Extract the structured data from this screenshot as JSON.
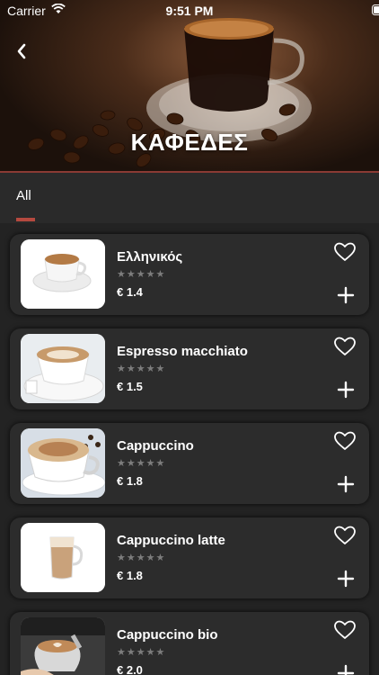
{
  "status_bar": {
    "carrier": "Carrier",
    "time": "9:51 PM"
  },
  "header": {
    "title": "ΚΑΦΕΔΕΣ",
    "back_icon": "chevron-left-icon"
  },
  "tabs": [
    {
      "label": "All",
      "selected": true
    }
  ],
  "accent_color": "#b5493f",
  "items": [
    {
      "name": "Ελληνικός",
      "rating": "★★★★★",
      "price": "€ 1.4",
      "image": "greek-coffee-cup"
    },
    {
      "name": "Espresso macchiato",
      "rating": "★★★★★",
      "price": "€ 1.5",
      "image": "espresso-macchiato-cup"
    },
    {
      "name": "Cappuccino",
      "rating": "★★★★★",
      "price": "€ 1.8",
      "image": "cappuccino-cup"
    },
    {
      "name": "Cappuccino latte",
      "rating": "★★★★★",
      "price": "€ 1.8",
      "image": "latte-glass"
    },
    {
      "name": "Cappuccino bio",
      "rating": "★★★★★",
      "price": "€ 2.0",
      "image": "latte-art-pour"
    }
  ]
}
